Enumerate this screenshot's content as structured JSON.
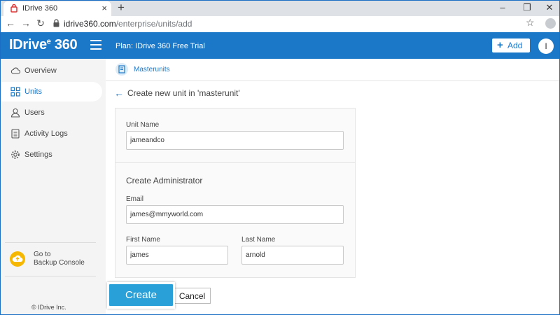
{
  "browser": {
    "tab_title": "IDrive 360",
    "tab_close": "×",
    "new_tab": "+",
    "url_host": "idrive360.com",
    "url_path": "/enterprise/units/add",
    "controls": {
      "minimize": "–",
      "restore": "❐",
      "close": "✕"
    },
    "nav": {
      "back": "←",
      "forward": "→",
      "reload": "↻"
    },
    "bookmark": "☆"
  },
  "header": {
    "logo_text": "IDrive",
    "logo_num": "360",
    "logo_sup": "e",
    "plan": "Plan: IDrive 360 Free Trial",
    "add_label": "Add",
    "avatar_initial": "I"
  },
  "sidebar": {
    "items": [
      {
        "label": "Overview",
        "icon": "cloud-icon",
        "active": false
      },
      {
        "label": "Units",
        "icon": "grid-icon",
        "active": true
      },
      {
        "label": "Users",
        "icon": "user-icon",
        "active": false
      },
      {
        "label": "Activity Logs",
        "icon": "log-icon",
        "active": false
      },
      {
        "label": "Settings",
        "icon": "gear-icon",
        "active": false
      }
    ],
    "console_line1": "Go to",
    "console_line2": "Backup Console",
    "copyright": "© IDrive Inc."
  },
  "main": {
    "breadcrumb": "Masterunits",
    "heading": "Create new unit in 'masterunit'",
    "form": {
      "unit_name_label": "Unit Name",
      "unit_name_value": "jameandco",
      "admin_title": "Create Administrator",
      "email_label": "Email",
      "email_value": "james@mmyworld.com",
      "first_name_label": "First Name",
      "first_name_value": "james",
      "last_name_label": "Last Name",
      "last_name_value": "arnold"
    },
    "create_label": "Create",
    "cancel_label": "Cancel"
  },
  "colors": {
    "brand": "#1b78c9",
    "create_button": "#2aa0d8",
    "console_icon": "#f5b700"
  }
}
